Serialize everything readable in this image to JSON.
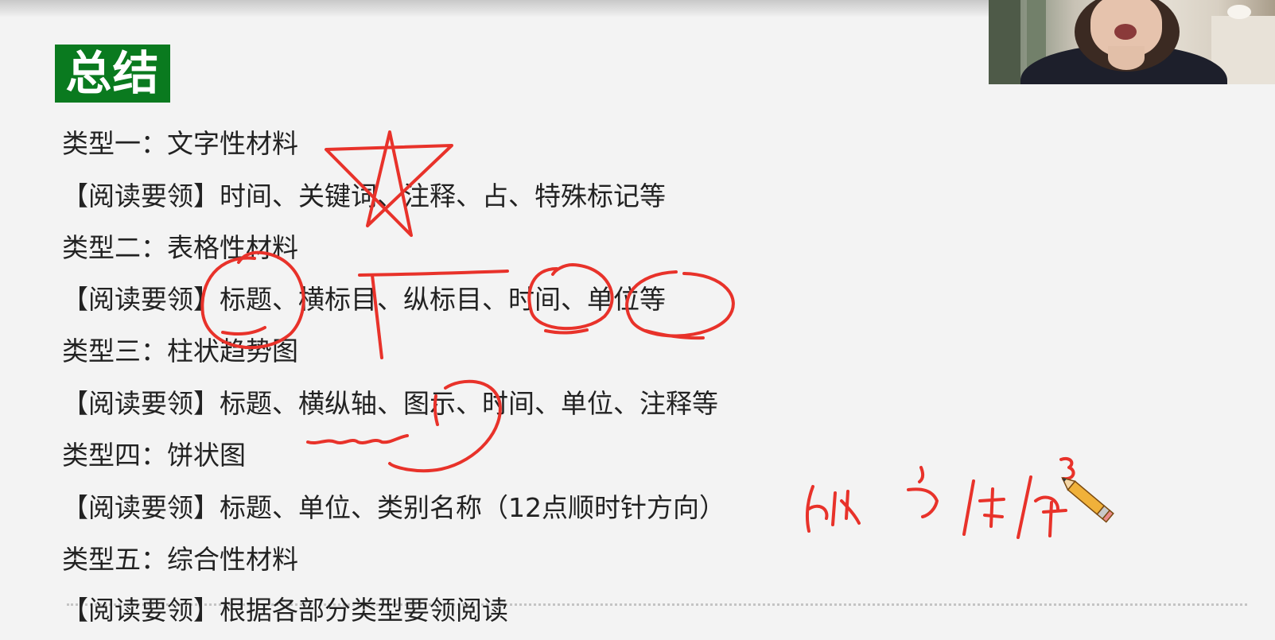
{
  "slide": {
    "badge": "总结",
    "lines": [
      "类型一：文字性材料",
      "【阅读要领】时间、关键词、注释、占、特殊标记等",
      "类型二：表格性材料",
      "【阅读要领】标题、横标目、纵标目、时间、单位等",
      "类型三：柱状趋势图",
      "【阅读要领】标题、横纵轴、图示、时间、单位、注释等",
      "类型四：饼状图",
      "【阅读要领】标题、单位、类别名称（12点顺时针方向）",
      "类型五：综合性材料",
      "【阅读要领】根据各部分类型要领阅读"
    ]
  },
  "annotations": {
    "ink_color": "#e8322a",
    "pencil_icon": "pencil-icon"
  },
  "colors": {
    "badge_bg": "#0a7a1f",
    "text": "#222222",
    "background": "#f3f3f3"
  }
}
